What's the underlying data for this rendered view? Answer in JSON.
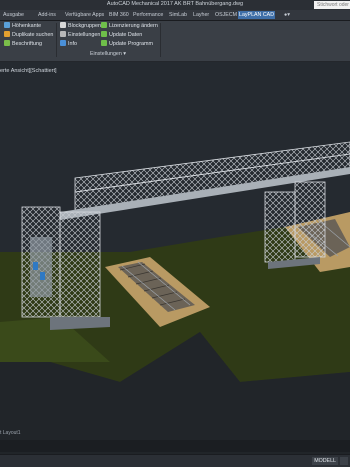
{
  "window": {
    "title": "AutoCAD Mechanical 2017   AK BRT Bahnübergang.dwg",
    "search_placeholder": "Stichwort oder"
  },
  "tabs": [
    {
      "label": "Ausgabe"
    },
    {
      "label": "Add-ins"
    },
    {
      "label": "Verfügbare Apps"
    },
    {
      "label": "BIM 360"
    },
    {
      "label": "Performance"
    },
    {
      "label": "SimLab"
    },
    {
      "label": "Layher"
    },
    {
      "label": "OSJECM"
    },
    {
      "label": "LayPLAN CAD",
      "active": true
    }
  ],
  "ribbon": {
    "left_buttons": [
      {
        "label": "Höhenkante",
        "color": "#5aa0d8"
      },
      {
        "label": "Duplikate suchen",
        "color": "#e2a02f"
      },
      {
        "label": "Beschriftung",
        "color": "#7bbf4a"
      }
    ],
    "right_buttons": [
      {
        "label": "Blockgruppen",
        "color": "#d8d8d8"
      },
      {
        "label": "Einstellungen",
        "color": "#b8b8b8"
      },
      {
        "label": "Info",
        "color": "#4a90d9"
      },
      {
        "label": "Lizenzierung ändern",
        "color": "#6fbf4a"
      },
      {
        "label": "Update Daten",
        "color": "#6fbf4a"
      },
      {
        "label": "Update Programm",
        "color": "#6fbf4a"
      }
    ],
    "panel_label": "Einstellungen ▾"
  },
  "viewport": {
    "label": "erte Ansicht][Schattiert]"
  },
  "layout_tabs": "t  Layout1",
  "status": {
    "mode": "MODELL"
  }
}
